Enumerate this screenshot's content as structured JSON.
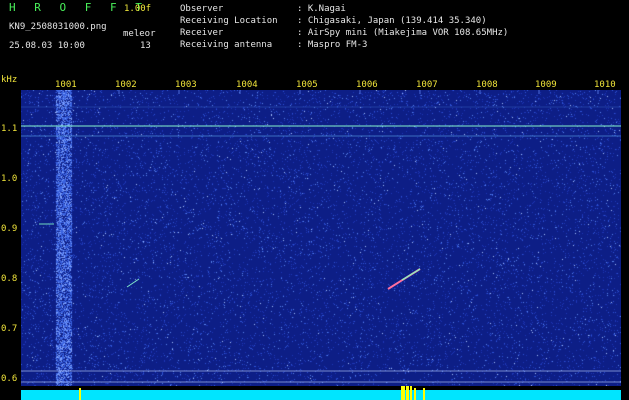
{
  "header": {
    "brand": "H R O F F T",
    "version": "1.00f",
    "filename": "KN9_2508031000.png",
    "mode": "meleor",
    "datetime": "25.08.03 10:00",
    "count": "13",
    "info_labels": [
      "Observer",
      "Receiving Location",
      "Receiver",
      "Receiving antenna"
    ],
    "info_values": [
      ": K.Nagai",
      ": Chigasaki, Japan (139.414 35.340)",
      ": AirSpy mini (Miakejima VOR 108.65MHz)",
      ": Maspro FM-3"
    ]
  },
  "axis": {
    "y_unit": "kHz",
    "y_ticks": [
      "1.1",
      "1.0",
      "0.9",
      "0.8",
      "0.7",
      "0.6"
    ],
    "x_ticks": [
      "1001",
      "1002",
      "1003",
      "1004",
      "1005",
      "1006",
      "1007",
      "1008",
      "1009",
      "1010"
    ]
  },
  "colors": {
    "background": "#0d1e86",
    "label_yellow": "#f0e43a",
    "green_text": "#49f05a",
    "cyan_baseline": "#00e5ff"
  }
}
